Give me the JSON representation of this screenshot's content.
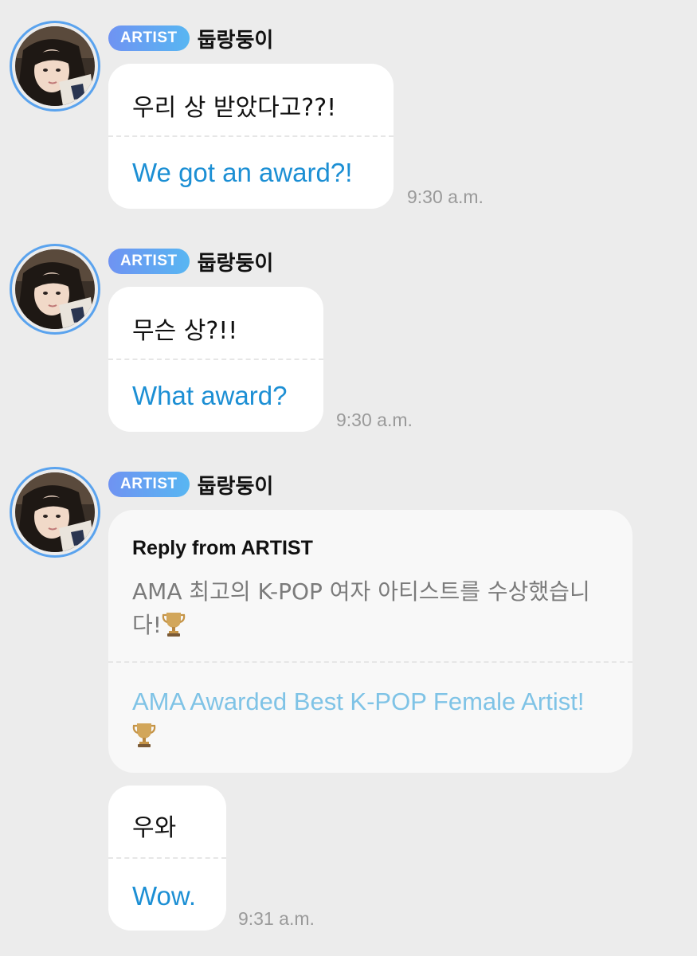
{
  "messages": [
    {
      "badge": "ARTIST",
      "sender": "둡랑둥이",
      "korean": "우리 상 받았다고??!",
      "english": "We got an award?!",
      "time": "9:30 a.m."
    },
    {
      "badge": "ARTIST",
      "sender": "둡랑둥이",
      "korean": "무슨 상?!!",
      "english": "What award?",
      "time": "9:30 a.m."
    },
    {
      "badge": "ARTIST",
      "sender": "둡랑둥이",
      "reply": {
        "title": "Reply from ARTIST",
        "korean": "AMA 최고의 K-POP 여자 아티스트를 수상했습니다!",
        "english": "AMA Awarded Best K-POP Female Artist!"
      },
      "korean": "우와",
      "english": "Wow.",
      "time": "9:31 a.m."
    }
  ],
  "icons": {
    "trophy": "trophy-icon",
    "avatar": "avatar"
  },
  "colors": {
    "background": "#ececec",
    "badge_start": "#6f93f2",
    "badge_end": "#58b6f2",
    "translation": "#1c8fd4",
    "reply_translation": "#7fc3e6",
    "timestamp": "#9a9a9a"
  }
}
